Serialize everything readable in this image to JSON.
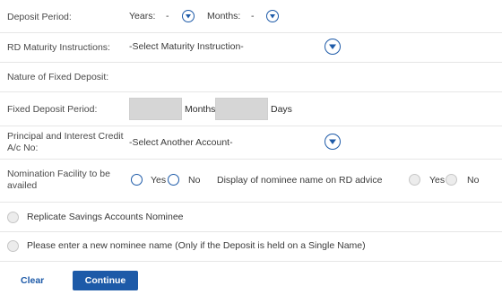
{
  "deposit_period": {
    "label": "Deposit Period:",
    "years_label": "Years:",
    "years_value": "-",
    "months_label": "Months:",
    "months_value": "-"
  },
  "maturity": {
    "label": "RD Maturity Instructions:",
    "value": "-Select Maturity Instruction-"
  },
  "nature": {
    "label": "Nature of Fixed Deposit:"
  },
  "fd_period": {
    "label": "Fixed Deposit Period:",
    "months_label": "Months",
    "days_label": "Days",
    "months_value": "",
    "days_value": ""
  },
  "credit_account": {
    "label_line1": "Principal and Interest Credit",
    "label_line2": "A/c No:",
    "value": "-Select Another Account-"
  },
  "nomination": {
    "label_line1": "Nomination Facility to be",
    "label_line2": "availed",
    "yes": "Yes",
    "no": "No",
    "display_label": "Display of nominee name on RD advice",
    "display_yes": "Yes",
    "display_no": "No"
  },
  "replicate": {
    "label": "Replicate Savings Accounts Nominee"
  },
  "new_nominee": {
    "label": "Please enter a new nominee name (Only if the Deposit is held on a Single Name)"
  },
  "actions": {
    "clear": "Clear",
    "continue": "Continue"
  },
  "colors": {
    "accent": "#1d5aa8",
    "divider": "#e6e6e6",
    "input_fill": "#d6d6d6"
  }
}
